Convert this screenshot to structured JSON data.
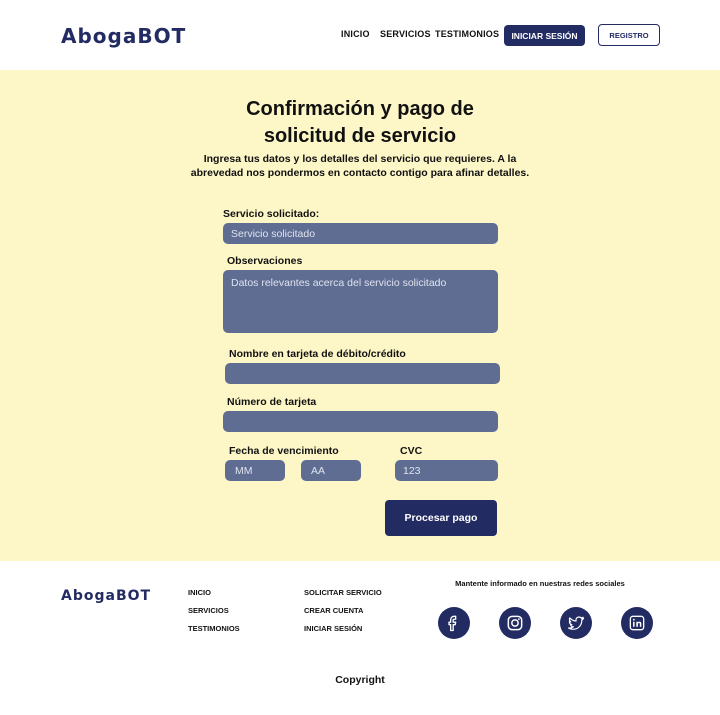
{
  "header": {
    "logo": "AbogaBOT",
    "nav": [
      "INICIO",
      "SERVICIOS",
      "TESTIMONIOS"
    ],
    "login_label": "INICIAR SESIÓN",
    "register_label": "REGISTRO"
  },
  "main": {
    "title_line1": "Confirmación y pago de",
    "title_line2": "solicitud de servicio",
    "subtitle": "Ingresa tus datos y los detalles del servicio que requieres. A la abrevedad nos pondermos en contacto contigo para afinar detalles.",
    "form": {
      "service_label": "Servicio solicitado:",
      "service_placeholder": "Servicio solicitado",
      "notes_label": "Observaciones",
      "notes_placeholder": "Datos relevantes acerca del servicio solicitado",
      "card_name_label": "Nombre en tarjeta de débito/crédito",
      "card_name_placeholder": "",
      "card_number_label": "Número de tarjeta",
      "card_number_placeholder": "",
      "expiry_label": "Fecha de vencimiento",
      "month_placeholder": "MM",
      "year_placeholder": "AA",
      "cvc_label": "CVC",
      "cvc_placeholder": "123",
      "submit_label": "Procesar pago"
    }
  },
  "footer": {
    "logo": "AbogaBOT",
    "col1": [
      "INICIO",
      "SERVICIOS",
      "TESTIMONIOS"
    ],
    "col2": [
      "SOLICITAR SERVICIO",
      "CREAR CUENTA",
      "INICIAR SESIÓN"
    ],
    "social_title": "Mantente informado en nuestras redes sociales",
    "social_icons": [
      "facebook-icon",
      "instagram-icon",
      "twitter-icon",
      "linkedin-icon"
    ],
    "copyright": "Copyright"
  },
  "colors": {
    "brand": "#232b63",
    "main_bg": "#fdf6c7",
    "field_bg": "#5f6d93"
  }
}
